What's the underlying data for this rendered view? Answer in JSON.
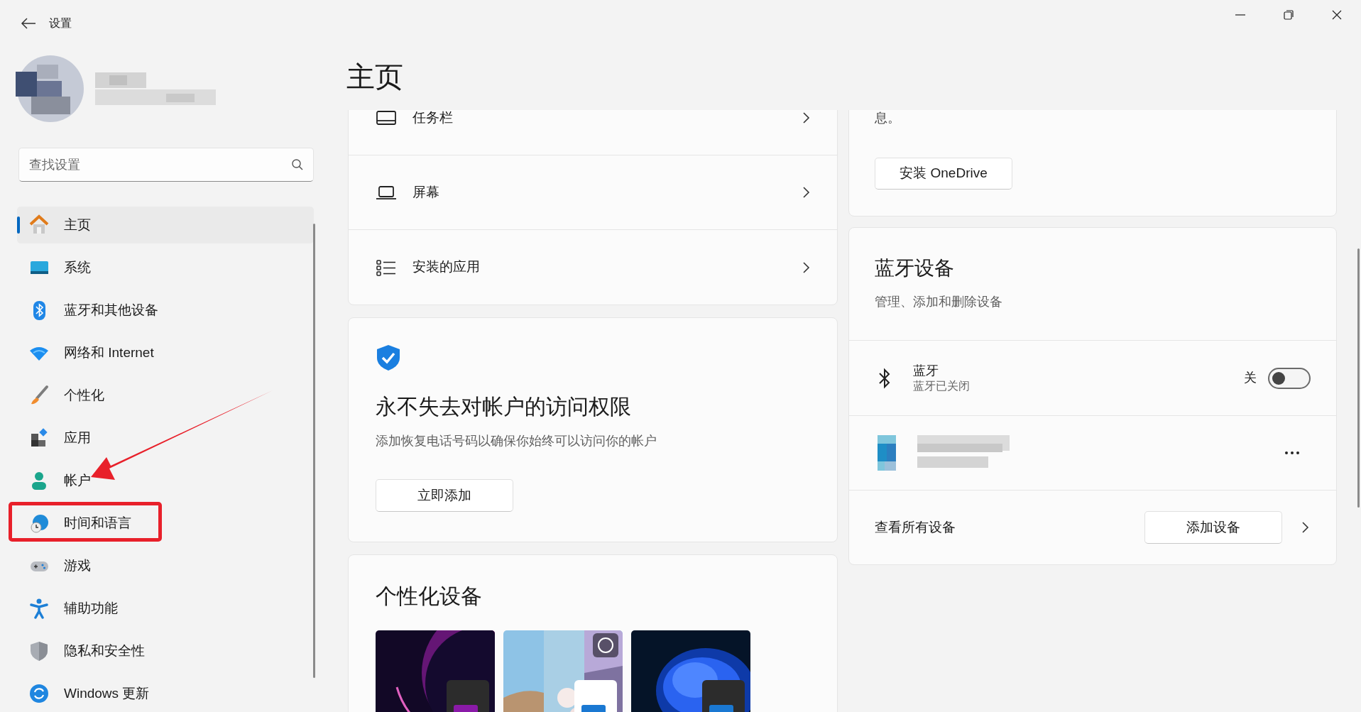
{
  "window": {
    "title": "设置"
  },
  "sidebar": {
    "search": {
      "placeholder": "查找设置"
    },
    "items": [
      {
        "label": "主页",
        "selected": true
      },
      {
        "label": "系统",
        "selected": false
      },
      {
        "label": "蓝牙和其他设备",
        "selected": false
      },
      {
        "label": "网络和 Internet",
        "selected": false
      },
      {
        "label": "个性化",
        "selected": false
      },
      {
        "label": "应用",
        "selected": false
      },
      {
        "label": "帐户",
        "selected": false
      },
      {
        "label": "时间和语言",
        "selected": false
      },
      {
        "label": "游戏",
        "selected": false
      },
      {
        "label": "辅助功能",
        "selected": false
      },
      {
        "label": "隐私和安全性",
        "selected": false
      },
      {
        "label": "Windows 更新",
        "selected": false
      }
    ]
  },
  "page": {
    "title": "主页",
    "quick_links": [
      {
        "label": "任务栏"
      },
      {
        "label": "屏幕"
      },
      {
        "label": "安装的应用"
      }
    ],
    "account_card": {
      "title": "永不失去对帐户的访问权限",
      "description": "添加恢复电话号码以确保你始终可以访问你的帐户",
      "button": "立即添加"
    },
    "personalize_card": {
      "title": "个性化设备"
    },
    "onedrive_card": {
      "text": "息。",
      "button": "安装 OneDrive"
    },
    "bluetooth_card": {
      "title": "蓝牙设备",
      "subtitle": "管理、添加和删除设备",
      "bluetooth": {
        "label": "蓝牙",
        "status": "蓝牙已关闭",
        "state_label": "关",
        "on": false
      },
      "footer": {
        "link": "查看所有设备",
        "button": "添加设备"
      }
    }
  }
}
